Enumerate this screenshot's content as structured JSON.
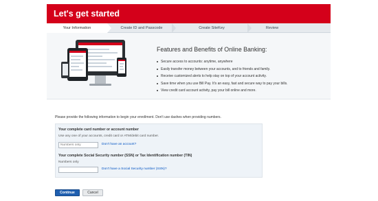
{
  "header": {
    "title": "Let's get started",
    "color": "#d4001a"
  },
  "steps": [
    {
      "label": "Your Information",
      "active": true
    },
    {
      "label": "Create ID and Passcode",
      "active": false
    },
    {
      "label": "Create SiteKey",
      "active": false
    },
    {
      "label": "Review",
      "active": false
    }
  ],
  "hero": {
    "title": "Features and Benefits of Online Banking:",
    "benefits": [
      "Secure access to accounts: anytime, anywhere",
      "Easily transfer money between your accounts, and to friends and family.",
      "Receive customized alerts to help stay on top of your account activity.",
      "Save time when you use Bill Pay. It's an easy, fast and secure way to pay your bills.",
      "View credit card account activity, pay your bill online and more."
    ],
    "illustration_icon": "devices-illustration"
  },
  "intro": "Please provide the following information to begin your enrollment. Don't use dashes when providing numbers.",
  "form": {
    "card": {
      "label": "Your complete card number or account number",
      "hint": "Use any one of your accounts, credit card or ATM/debit card number.",
      "placeholder": "Numbers only",
      "help_link": "Don't have an account?"
    },
    "ssn": {
      "label": "Your complete Social Security number (SSN) or Tax Identification number (TIN)",
      "hint": "Numbers only",
      "help_link": "Don't have a Social Security number (SSN)?"
    }
  },
  "buttons": {
    "continue": "Continue",
    "cancel": "Cancel"
  },
  "colors": {
    "brand_red": "#d4001a",
    "primary_blue": "#1f5fb0",
    "link_blue": "#0052c2"
  }
}
